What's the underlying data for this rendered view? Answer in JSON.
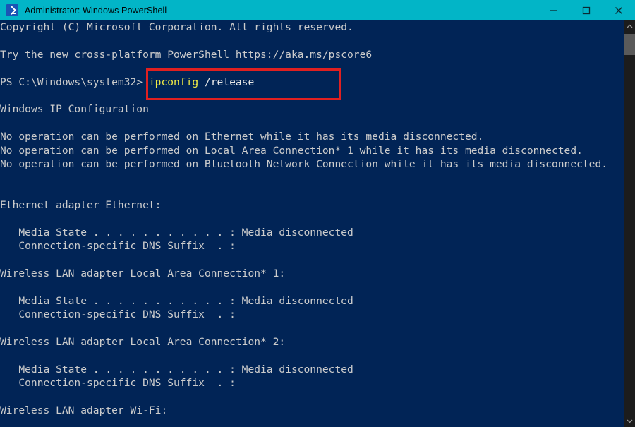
{
  "window": {
    "title": "Administrator: Windows PowerShell",
    "icon": "powershell-prompt-icon",
    "titlebar_color": "#02b5c7",
    "terminal_bg": "#012456",
    "controls": {
      "minimize": "Minimize",
      "maximize": "Maximize",
      "close": "Close"
    }
  },
  "annotation": {
    "color": "#e02020",
    "target": "ipconfig /release"
  },
  "prompt": {
    "path": "PS C:\\Windows\\system32> ",
    "command": "ipconfig",
    "arguments": " /release",
    "command_color": "#f0ea45",
    "argument_color": "#e8e8e8"
  },
  "scrollbar": {
    "up_arrow": "chevron-up-icon",
    "down_arrow": "chevron-down-icon",
    "thumb_color": "#5a5a5a",
    "track_color": "#1c1c1c"
  },
  "console": {
    "lines": [
      "Copyright (C) Microsoft Corporation. All rights reserved.",
      "",
      "Try the new cross-platform PowerShell https://aka.ms/pscore6",
      "",
      "__PROMPT__",
      "",
      "Windows IP Configuration",
      "",
      "No operation can be performed on Ethernet while it has its media disconnected.",
      "No operation can be performed on Local Area Connection* 1 while it has its media disconnected.",
      "No operation can be performed on Bluetooth Network Connection while it has its media disconnected.",
      "",
      "",
      "Ethernet adapter Ethernet:",
      "",
      "   Media State . . . . . . . . . . . : Media disconnected",
      "   Connection-specific DNS Suffix  . :",
      "",
      "Wireless LAN adapter Local Area Connection* 1:",
      "",
      "   Media State . . . . . . . . . . . : Media disconnected",
      "   Connection-specific DNS Suffix  . :",
      "",
      "Wireless LAN adapter Local Area Connection* 2:",
      "",
      "   Media State . . . . . . . . . . . : Media disconnected",
      "   Connection-specific DNS Suffix  . :",
      "",
      "Wireless LAN adapter Wi-Fi:",
      ""
    ]
  }
}
